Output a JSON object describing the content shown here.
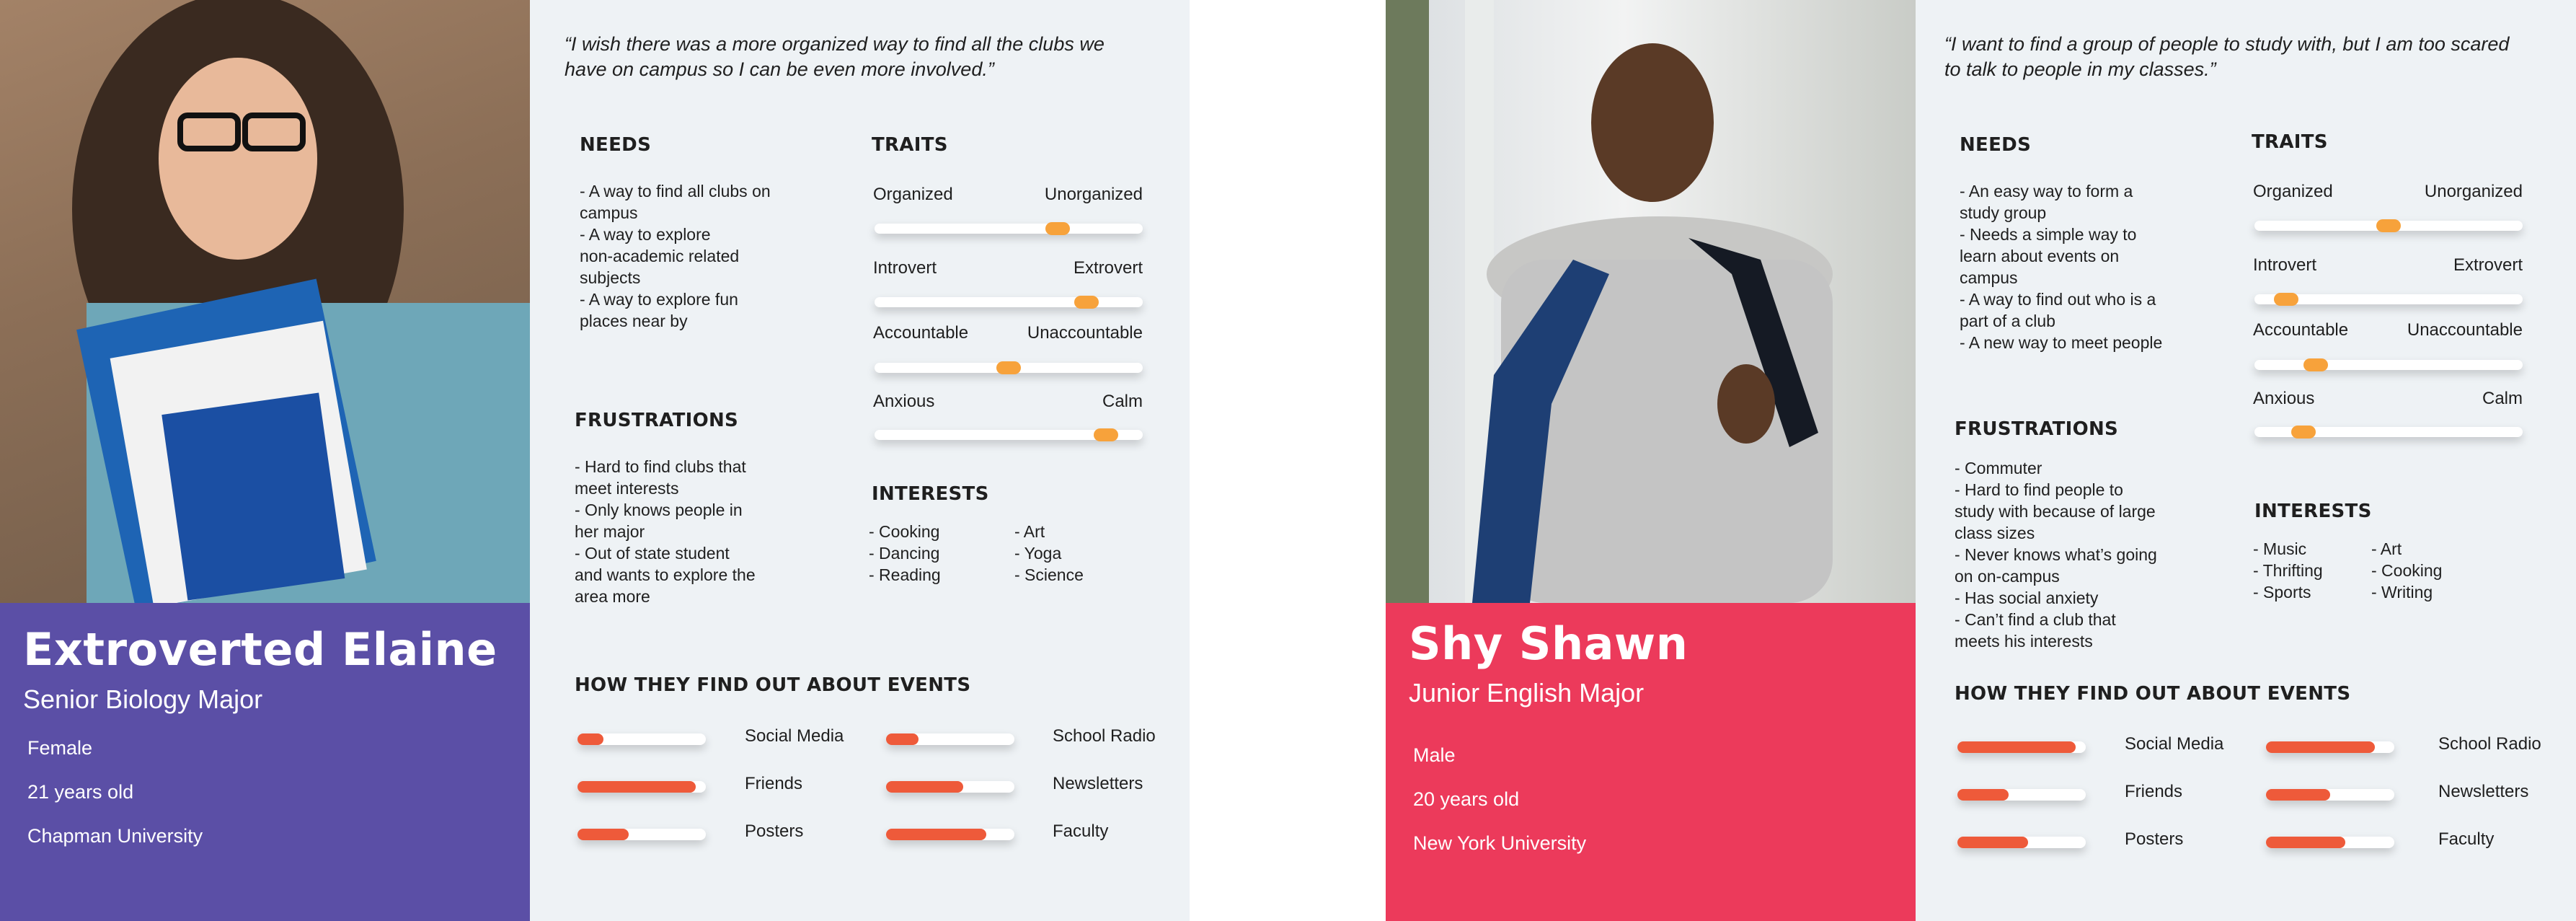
{
  "colors": {
    "accent_bar": "#ee5a3a",
    "trait_knob": "#f7a23b",
    "elaine_card": "#5b4fa6",
    "shawn_card": "#ec3a5b",
    "panel_bg": "#eef2f5"
  },
  "personas": [
    {
      "photo_icon": "portrait-photo",
      "name": "Extroverted Elaine",
      "role": "Senior Biology Major",
      "info": [
        "Female",
        "21 years old",
        "Chapman University"
      ],
      "quote": "“I wish there was a more organized way to find all the clubs we have on campus so I can be even more involved.”",
      "needs_title": "NEEDS",
      "needs": [
        "- A way to find all clubs on",
        "campus",
        "- A way to explore",
        "non-academic related",
        "subjects",
        "- A way to explore fun",
        "places near by"
      ],
      "frustrations_title": "FRUSTRATIONS",
      "frustrations": [
        "- Hard to find clubs that",
        "meet interests",
        "- Only knows people in",
        "her major",
        "- Out of state student",
        "and wants to explore the",
        "area more"
      ],
      "traits_title": "TRAITS",
      "traits": [
        {
          "left": "Organized",
          "right": "Unorganized",
          "value": 0.7
        },
        {
          "left": "Introvert",
          "right": "Extrovert",
          "value": 0.82
        },
        {
          "left": "Accountable",
          "right": "Unaccountable",
          "value": 0.5
        },
        {
          "left": "Anxious",
          "right": "Calm",
          "value": 0.9
        }
      ],
      "interests_title": "INTERESTS",
      "interests": [
        [
          "- Cooking",
          "- Dancing",
          "- Reading"
        ],
        [
          "- Art",
          "- Yoga",
          "- Science"
        ]
      ],
      "events_title": "HOW THEY FIND OUT ABOUT EVENTS",
      "events": [
        {
          "label": "Social Media",
          "value": 0.2
        },
        {
          "label": "School Radio",
          "value": 0.25
        },
        {
          "label": "Friends",
          "value": 0.92
        },
        {
          "label": "Newsletters",
          "value": 0.6
        },
        {
          "label": "Posters",
          "value": 0.4
        },
        {
          "label": "Faculty",
          "value": 0.78
        }
      ]
    },
    {
      "photo_icon": "portrait-photo",
      "name": "Shy Shawn",
      "role": "Junior English Major",
      "info": [
        "Male",
        "20 years old",
        "New York University"
      ],
      "quote": "“I want to find a group of people to study with, but I am too scared to talk to people in my classes.”",
      "needs_title": "NEEDS",
      "needs": [
        "- An easy way to form a",
        "study group",
        "- Needs a simple way to",
        "learn about events on",
        "campus",
        "- A way to find out who is a",
        "part of a club",
        "- A new way to meet people"
      ],
      "frustrations_title": "FRUSTRATIONS",
      "frustrations": [
        "- Commuter",
        "- Hard to find people to",
        "study with because of large",
        "class sizes",
        "- Never knows what’s going",
        "on on-campus",
        "- Has social anxiety",
        "- Can’t find a club that",
        "meets his interests"
      ],
      "traits_title": "TRAITS",
      "traits": [
        {
          "left": "Organized",
          "right": "Unorganized",
          "value": 0.5
        },
        {
          "left": "Introvert",
          "right": "Extrovert",
          "value": 0.08
        },
        {
          "left": "Accountable",
          "right": "Unaccountable",
          "value": 0.2
        },
        {
          "left": "Anxious",
          "right": "Calm",
          "value": 0.15
        }
      ],
      "interests_title": "INTERESTS",
      "interests": [
        [
          "- Music",
          "- Thrifting",
          "- Sports"
        ],
        [
          "- Art",
          "- Cooking",
          "- Writing"
        ]
      ],
      "events_title": "HOW THEY FIND OUT ABOUT EVENTS",
      "events": [
        {
          "label": "Social Media",
          "value": 0.92
        },
        {
          "label": "School Radio",
          "value": 0.85
        },
        {
          "label": "Friends",
          "value": 0.4
        },
        {
          "label": "Newsletters",
          "value": 0.5
        },
        {
          "label": "Posters",
          "value": 0.55
        },
        {
          "label": "Faculty",
          "value": 0.62
        }
      ]
    }
  ]
}
